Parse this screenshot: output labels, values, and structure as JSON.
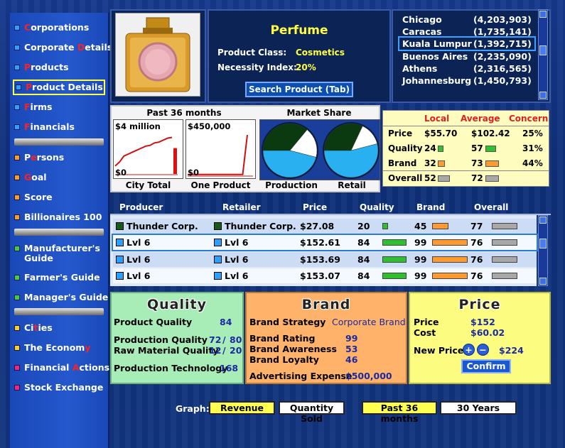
{
  "sidebar": {
    "group1": [
      {
        "pre": "",
        "hl": "C",
        "post": "orporations",
        "dot": "#2aa0ff"
      },
      {
        "pre": "Corporate ",
        "hl": "D",
        "post": "etails",
        "dot": "#2aa0ff"
      },
      {
        "pre": "",
        "hl": "P",
        "post": "roducts",
        "dot": "#2aa0ff"
      },
      {
        "pre": "",
        "hl": "P",
        "post": "roduct Details",
        "dot": "#2aa0ff"
      },
      {
        "pre": "",
        "hl": "F",
        "post": "irms",
        "dot": "#2aa0ff"
      },
      {
        "pre": "",
        "hl": "F",
        "post": "inancials",
        "dot": "#2aa0ff"
      }
    ],
    "group2": [
      {
        "pre": "P",
        "hl": "e",
        "post": "rsons",
        "dot": "#ff9a20"
      },
      {
        "pre": "",
        "hl": "G",
        "post": "oal",
        "dot": "#ff9a20"
      },
      {
        "pre": "Score",
        "hl": "",
        "post": "",
        "dot": "#ff9a20"
      },
      {
        "pre": "Billionaires 100",
        "hl": "",
        "post": "",
        "dot": "#ff9a20"
      }
    ],
    "group3": [
      {
        "pre": "Manufacturer's",
        "hl": "",
        "post": "",
        "dot": "#3ad040"
      },
      {
        "pre": "Guide",
        "hl": "",
        "post": "",
        "dot": ""
      },
      {
        "pre": "Farmer's Guide",
        "hl": "",
        "post": "",
        "dot": "#3ad040"
      },
      {
        "pre": "Manager's Guide",
        "hl": "",
        "post": "",
        "dot": "#3ad040"
      }
    ],
    "group4": [
      {
        "pre": "Ci",
        "hl": "t",
        "post": "ies",
        "dot": "#ffcc20"
      },
      {
        "pre": "The Econom",
        "hl": "y",
        "post": "",
        "dot": "#ffcc20"
      },
      {
        "pre": "Financial ",
        "hl": "A",
        "post": "ctions",
        "dot": "#ff2080"
      },
      {
        "pre": "Stock Exchange",
        "hl": "",
        "post": "",
        "dot": "#ff2080"
      }
    ]
  },
  "product": {
    "name": "Perfume",
    "class_label": "Product Class:",
    "class_value": "Cosmetics",
    "necessity_label": "Necessity Index:",
    "necessity_value": "20%",
    "search_button": "Search Product (Tab)"
  },
  "cities": [
    {
      "name": "Chicago",
      "pop": "(4,203,903)"
    },
    {
      "name": "Caracas",
      "pop": "(1,735,141)"
    },
    {
      "name": "Kuala Lumpur",
      "pop": "(1,392,715)"
    },
    {
      "name": "Buenos Aires",
      "pop": "(2,235,090)"
    },
    {
      "name": "Athens",
      "pop": "(2,316,565)"
    },
    {
      "name": "Johannesburg",
      "pop": "(1,450,793)"
    }
  ],
  "charts": {
    "past_title": "Past 36 months",
    "city_total": {
      "label": "City Total",
      "top": "$4 million",
      "bottom": "$0"
    },
    "one_product": {
      "label": "One Product",
      "top": "$450,000",
      "bottom": "$0"
    },
    "market_title": "Market Share",
    "production_label": "Production",
    "retail_label": "Retail"
  },
  "chart_data": [
    {
      "type": "line",
      "title": "City Total",
      "series": [
        {
          "name": "",
          "values": [
            0.2,
            0.3,
            0.45,
            0.5,
            0.55,
            0.6,
            0.65,
            0.7,
            0.72,
            0.78,
            0.8,
            0.85,
            0.9,
            0.92
          ]
        }
      ],
      "bar_last": 0.65
    },
    {
      "type": "line",
      "title": "One Product",
      "series": [
        {
          "name": "",
          "values": [
            0.02,
            0.02,
            0.02,
            0.02,
            0.02,
            0.02,
            0.02,
            0.02,
            0.02,
            0.02,
            0.02,
            0.02,
            0.02,
            0.95
          ]
        }
      ]
    },
    {
      "type": "pie",
      "title": "Production",
      "slices": [
        0.36,
        0.18,
        0.46
      ]
    },
    {
      "type": "pie",
      "title": "Retail",
      "slices": [
        0.32,
        0.14,
        0.54
      ]
    }
  ],
  "compare": {
    "headers": [
      "Local",
      "Average",
      "Concern"
    ],
    "rows": [
      {
        "label": "Price",
        "local": "$55.70",
        "avg": "$102.42",
        "concern": "25%",
        "lbar": 0,
        "abar": 0
      },
      {
        "label": "Quality",
        "local": "24",
        "avg": "57",
        "concern": "31%",
        "lbar": 0.24,
        "abar": 0.57,
        "color": "#30c030"
      },
      {
        "label": "Brand",
        "local": "32",
        "avg": "73",
        "concern": "44%",
        "lbar": 0.32,
        "abar": 0.73,
        "color": "#ff9a30"
      },
      {
        "label": "Overall",
        "local": "52",
        "avg": "72",
        "concern": "",
        "lbar": 0.52,
        "abar": 0.72,
        "color": "#a8a8a8"
      }
    ]
  },
  "producers": {
    "headers": [
      "Producer",
      "Retailer",
      "Price",
      "Quality",
      "Brand",
      "Overall"
    ],
    "rows": [
      {
        "producer": "Thunder Corp.",
        "retailer": "Thunder Corp.",
        "price": "$27.08",
        "quality": "20",
        "brand": "45",
        "overall": "77",
        "pcolor": "#145a1a",
        "qbar": 0.2,
        "bbar": 0.45,
        "obar": 0.77
      },
      {
        "producer": "Lvl 6",
        "retailer": "Lvl 6",
        "price": "$152.61",
        "quality": "84",
        "brand": "99",
        "overall": "76",
        "pcolor": "#2aa0ff",
        "qbar": 0.84,
        "bbar": 0.99,
        "obar": 0.76
      },
      {
        "producer": "Lvl 6",
        "retailer": "Lvl 6",
        "price": "$153.69",
        "quality": "84",
        "brand": "99",
        "overall": "76",
        "pcolor": "#2aa0ff",
        "qbar": 0.84,
        "bbar": 0.99,
        "obar": 0.76
      },
      {
        "producer": "Lvl 6",
        "retailer": "Lvl 6",
        "price": "$153.07",
        "quality": "84",
        "brand": "99",
        "overall": "76",
        "pcolor": "#2aa0ff",
        "qbar": 0.84,
        "bbar": 0.99,
        "obar": 0.76
      }
    ]
  },
  "quality_panel": {
    "title": "Quality",
    "product_quality_label": "Product Quality",
    "product_quality": "84",
    "production_quality_label": "Production Quality",
    "production_quality": "72",
    "production_quality_max": "80",
    "raw_quality_label": "Raw Material Quality",
    "raw_quality": "12",
    "raw_quality_max": "20",
    "tech_label": "Production Technology",
    "tech": "168",
    "slash": "/"
  },
  "brand_panel": {
    "title": "Brand",
    "strategy_label": "Brand Strategy",
    "strategy": "Corporate Brand",
    "rating_label": "Brand Rating",
    "rating": "99",
    "awareness_label": "Brand Awareness",
    "awareness": "53",
    "loyalty_label": "Brand Loyalty",
    "loyalty": "46",
    "ad_label": "Advertising Expense",
    "ad": "$500,000"
  },
  "price_panel": {
    "title": "Price",
    "price_label": "Price",
    "price": "$152",
    "cost_label": "Cost",
    "cost": "$60.02",
    "new_price_label": "New Price",
    "new_price": "$224",
    "plus": "+",
    "minus": "−",
    "confirm": "Confirm"
  },
  "graph": {
    "label": "Graph:",
    "revenue": "Revenue",
    "quantity": "Quantity Sold",
    "past36": "Past 36 months",
    "years30": "30 Years"
  }
}
